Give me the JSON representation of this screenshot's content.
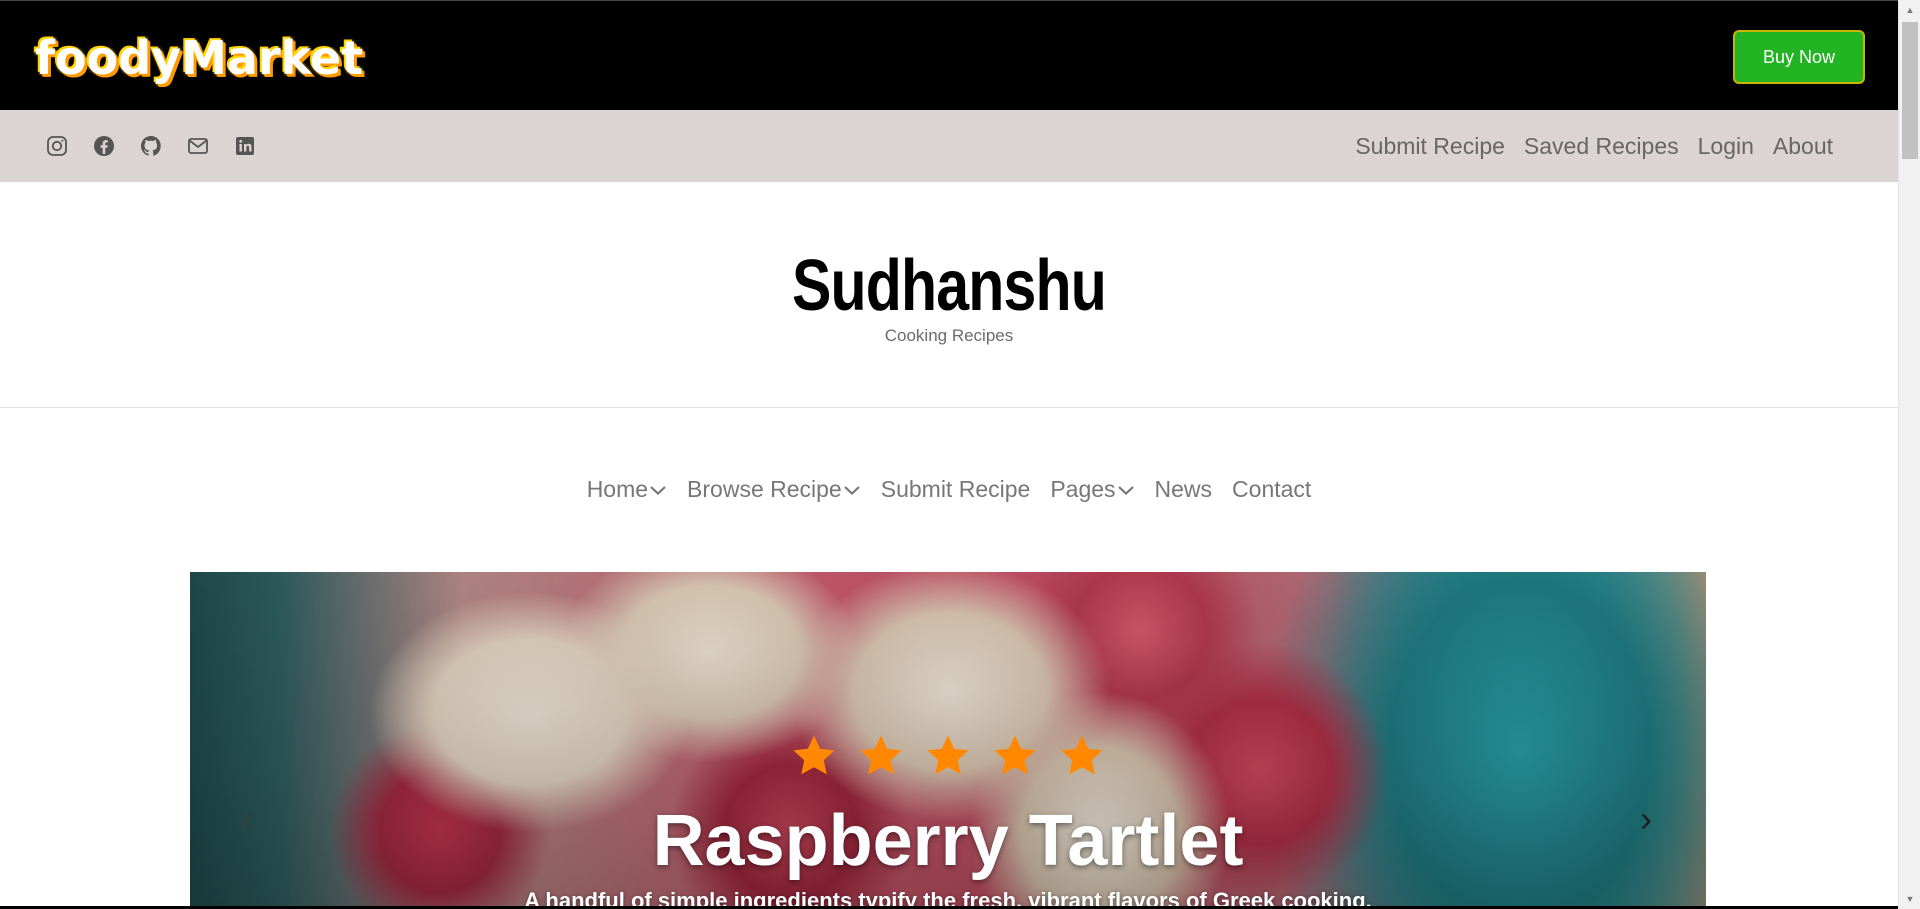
{
  "brand": {
    "name": "foodyMarket"
  },
  "topbar": {
    "buy_label": "Buy Now"
  },
  "social": [
    "instagram-icon",
    "facebook-icon",
    "github-icon",
    "mail-icon",
    "linkedin-icon"
  ],
  "toplinks": [
    "Submit Recipe",
    "Saved Recipes",
    "Login",
    "About"
  ],
  "header": {
    "title": "Sudhanshu",
    "subtitle": "Cooking Recipes"
  },
  "nav": [
    {
      "label": "Home",
      "dropdown": true
    },
    {
      "label": "Browse Recipe",
      "dropdown": true
    },
    {
      "label": "Submit Recipe",
      "dropdown": false
    },
    {
      "label": "Pages",
      "dropdown": true
    },
    {
      "label": "News",
      "dropdown": false
    },
    {
      "label": "Contact",
      "dropdown": false
    }
  ],
  "slide": {
    "rating": 5,
    "rating_max": 5,
    "title": "Raspberry Tartlet",
    "description": "A handful of simple ingredients typify the fresh, vibrant flavors of Greek cooking.",
    "prev_symbol": "‹",
    "next_symbol": "›"
  },
  "colors": {
    "buy": "#22b422",
    "subbar": "#dcd3d3",
    "star": "#ff8800"
  }
}
